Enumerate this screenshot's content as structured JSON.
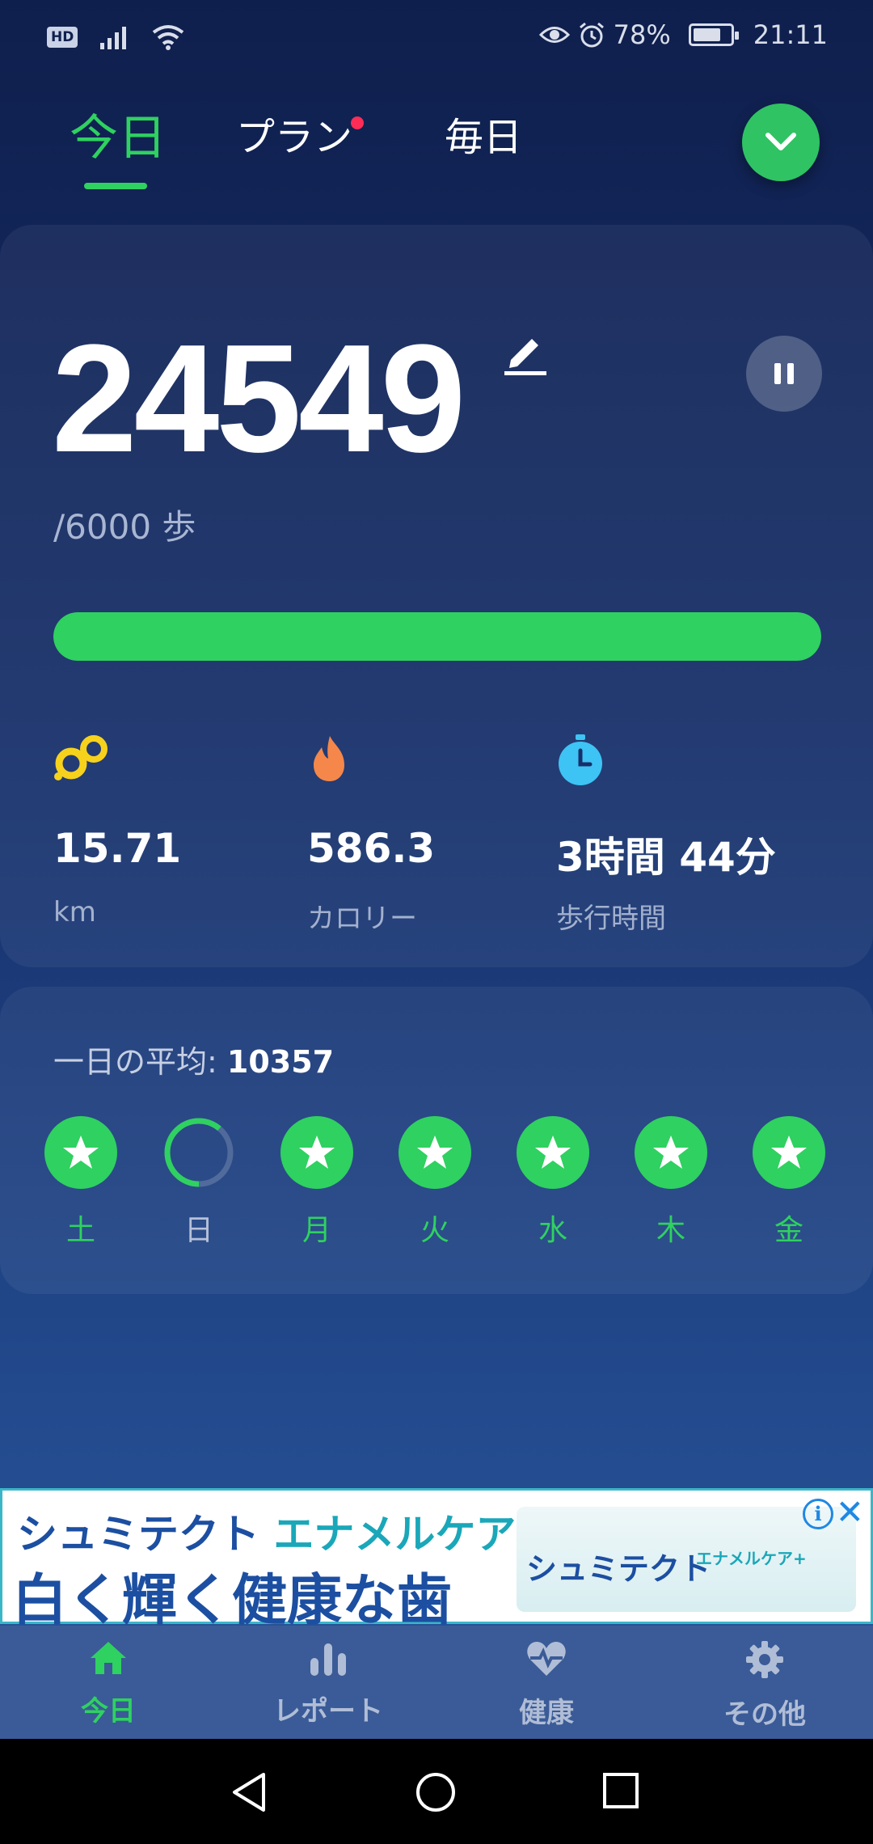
{
  "status_bar": {
    "hd_badge": "HD",
    "battery": "78%",
    "battery_level": 0.78,
    "time": "21:11"
  },
  "tabs": {
    "today": "今日",
    "plan": "プラン",
    "daily": "毎日"
  },
  "today_card": {
    "steps": "24549",
    "goal": "/6000 歩",
    "progress_percent": 100,
    "stats": {
      "distance": {
        "value": "15.71",
        "label": "km",
        "icon": "footprint-icon",
        "color": "#f7d21c"
      },
      "calories": {
        "value": "586.3",
        "label": "カロリー",
        "icon": "flame-icon",
        "color": "#f5874a"
      },
      "time": {
        "value": "3時間 44分",
        "label": "歩行時間",
        "icon": "stopwatch-icon",
        "color": "#3ec3f5"
      }
    }
  },
  "average": {
    "label": "一日の平均: ",
    "value": "10357",
    "days": [
      {
        "label": "土",
        "status": "achieved"
      },
      {
        "label": "日",
        "status": "partial"
      },
      {
        "label": "月",
        "status": "achieved"
      },
      {
        "label": "火",
        "status": "achieved"
      },
      {
        "label": "水",
        "status": "achieved"
      },
      {
        "label": "木",
        "status": "achieved"
      },
      {
        "label": "金",
        "status": "achieved"
      }
    ]
  },
  "ad": {
    "line1_brand": "シュミテクト",
    "line1_product": "エナメルケア+",
    "line2": "白く輝く健康な歯",
    "product_name": "シュミテクト",
    "product_sub": "エナメルケア+"
  },
  "bottom_nav": {
    "today": "今日",
    "report": "レポート",
    "health": "健康",
    "other": "その他"
  },
  "colors": {
    "accent_green": "#2fd160",
    "background": "#17306a",
    "plan_dot": "#ff2d55"
  }
}
